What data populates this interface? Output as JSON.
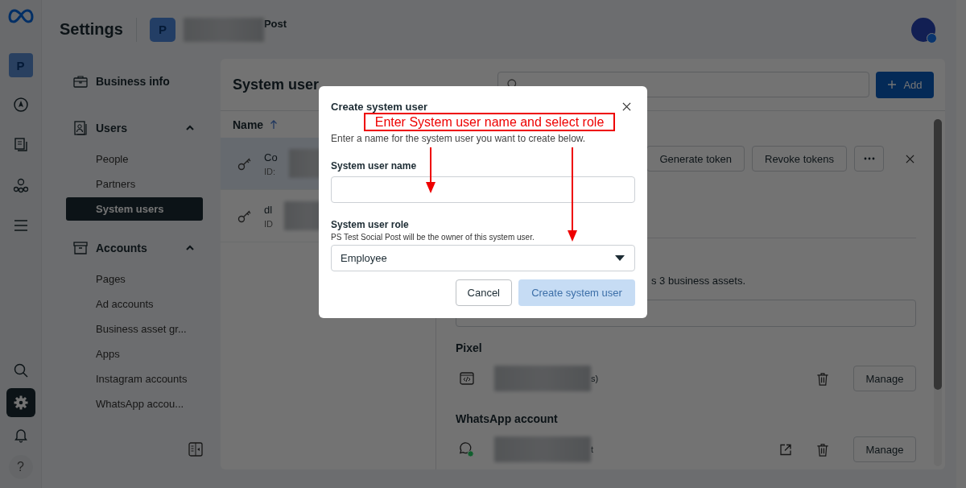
{
  "rail": {
    "account_avatar": "P",
    "items": [
      {
        "kind": "compass",
        "selected": false
      },
      {
        "kind": "pages",
        "selected": false
      },
      {
        "kind": "network",
        "selected": false
      },
      {
        "kind": "menu",
        "selected": false
      }
    ],
    "bottom_items": [
      {
        "kind": "search",
        "selected": false
      },
      {
        "kind": "settings",
        "selected": true
      },
      {
        "kind": "notifications",
        "selected": false
      },
      {
        "kind": "help",
        "label": "?",
        "selected": false
      }
    ]
  },
  "header": {
    "title": "Settings",
    "business_avatar": "P",
    "business_name": "Post"
  },
  "sidebar": {
    "sections": [
      {
        "kind": "link",
        "label": "Business info"
      },
      {
        "kind": "group",
        "label": "Users",
        "expanded": true,
        "items": [
          {
            "label": "People",
            "selected": false
          },
          {
            "label": "Partners",
            "selected": false
          },
          {
            "label": "System users",
            "selected": true
          }
        ]
      },
      {
        "kind": "group",
        "label": "Accounts",
        "expanded": true,
        "items": [
          {
            "label": "Pages",
            "selected": false
          },
          {
            "label": "Ad accounts",
            "selected": false
          },
          {
            "label": "Business asset gr...",
            "selected": false
          },
          {
            "label": "Apps",
            "selected": false
          },
          {
            "label": "Instagram accounts",
            "selected": false
          },
          {
            "label": "WhatsApp accou...",
            "selected": false
          }
        ]
      }
    ]
  },
  "main": {
    "title": "System user",
    "add_button": "Add",
    "list": {
      "column": "Name",
      "rows": [
        {
          "name": "Co",
          "id": "ID:",
          "selected": true
        },
        {
          "name": "dl",
          "id": "ID",
          "selected": false
        }
      ]
    },
    "detail": {
      "actions": [
        "Generate token",
        "Revoke tokens"
      ],
      "assets_summary": "s 3 business assets.",
      "sections": [
        {
          "title": "Pixel",
          "rows": [
            {
              "text": "s)",
              "external_link": false,
              "button": "Manage"
            }
          ]
        },
        {
          "title": "WhatsApp account",
          "rows": [
            {
              "text": "t",
              "external_link": true,
              "button": "Manage"
            }
          ]
        }
      ]
    }
  },
  "modal": {
    "title": "Create system user",
    "description": "Enter a name for the system user you want to create below.",
    "fields": [
      {
        "kind": "text",
        "label": "System user name"
      },
      {
        "kind": "select",
        "label": "System user role",
        "helper": "PS Test Social Post will be the owner of this system user.",
        "value": "Employee"
      }
    ],
    "buttons": [
      {
        "kind": "secondary",
        "label": "Cancel",
        "disabled": false
      },
      {
        "kind": "primary",
        "label": "Create system user",
        "disabled": true
      }
    ]
  },
  "annotation": {
    "text": "Enter System user name and select role"
  }
}
